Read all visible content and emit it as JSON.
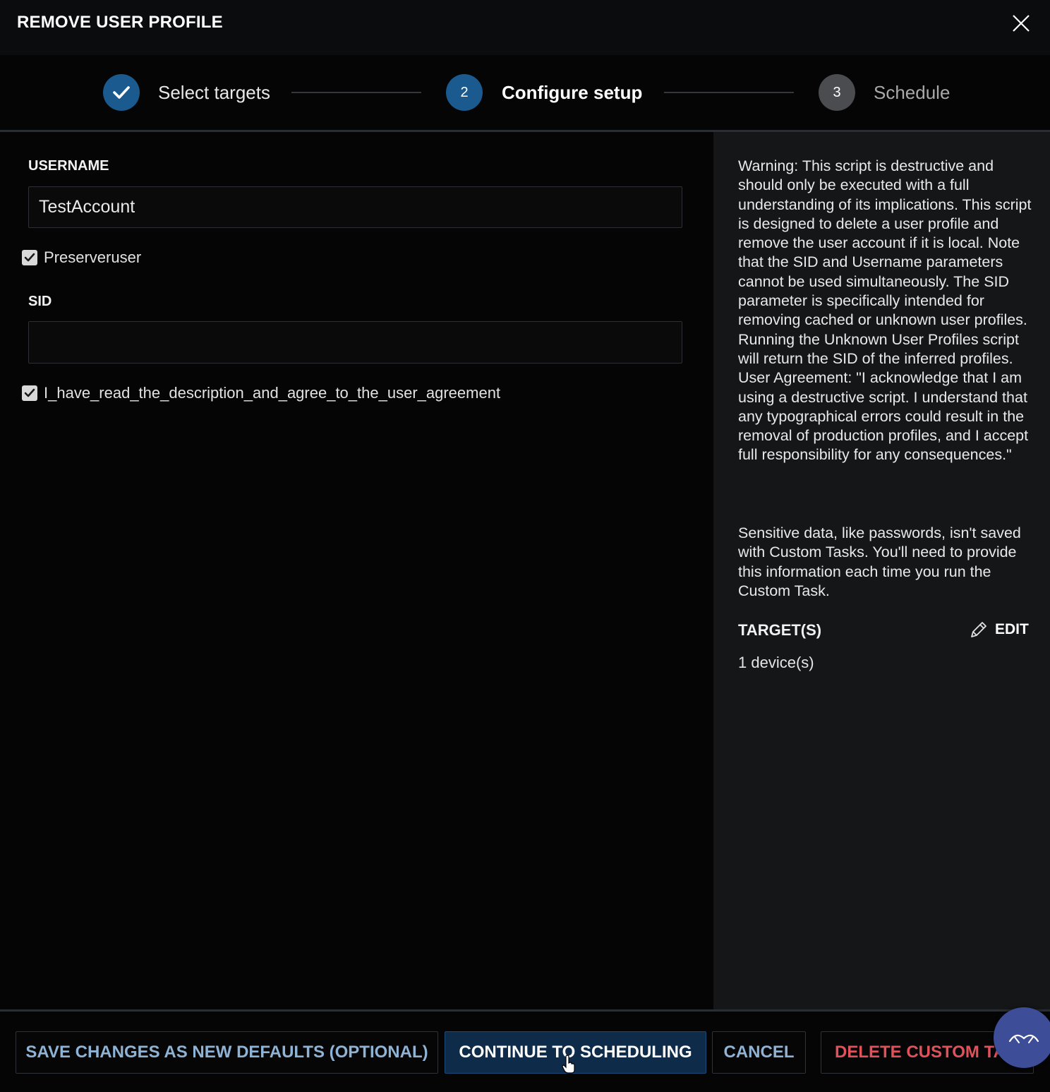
{
  "dialog": {
    "title": "REMOVE USER PROFILE"
  },
  "steps": [
    {
      "number": "1",
      "label": "Select targets",
      "state": "completed"
    },
    {
      "number": "2",
      "label": "Configure setup",
      "state": "active"
    },
    {
      "number": "3",
      "label": "Schedule",
      "state": "pending"
    }
  ],
  "form": {
    "username_label": "USERNAME",
    "username_value": "TestAccount",
    "preserveruser_label": "Preserveruser",
    "preserveruser_checked": true,
    "sid_label": "SID",
    "sid_value": "",
    "agreement_label": "I_have_read_the_description_and_agree_to_the_user_agreement",
    "agreement_checked": true
  },
  "info_panel": {
    "warning_text": "Warning: This script is destructive and should only be executed with a full understanding of its implications. This script is designed to delete a user profile and remove the user account if it is local. Note that the SID and Username parameters cannot be used simultaneously. The SID parameter is specifically intended for removing cached or unknown user profiles. Running the Unknown User Profiles script will return the SID of the inferred profiles. User Agreement: \"I acknowledge that I am using a destructive script. I understand that any typographical errors could result in the removal of production profiles, and I accept full responsibility for any consequences.\"",
    "sensitive_text": "Sensitive data, like passwords, isn't saved with Custom Tasks. You'll need to provide this information each time you run the Custom Task.",
    "targets_label": "TARGET(S)",
    "edit_label": "EDIT",
    "device_count": "1 device(s)"
  },
  "footer": {
    "save_defaults_label": "SAVE CHANGES AS NEW DEFAULTS (OPTIONAL)",
    "continue_label": "CONTINUE TO SCHEDULING",
    "cancel_label": "CANCEL",
    "delete_label": "DELETE CUSTOM TASK"
  },
  "icons": {
    "close": "close-icon",
    "step_done": "checkmark-icon",
    "edit": "pencil-icon",
    "assistant": "assistant-icon",
    "cursor": "hand-pointer-icon"
  },
  "colors": {
    "accent": "#1a5a8e",
    "step_pending": "#4a4c4f",
    "danger": "#e0525a",
    "link": "#8fb3d4"
  }
}
